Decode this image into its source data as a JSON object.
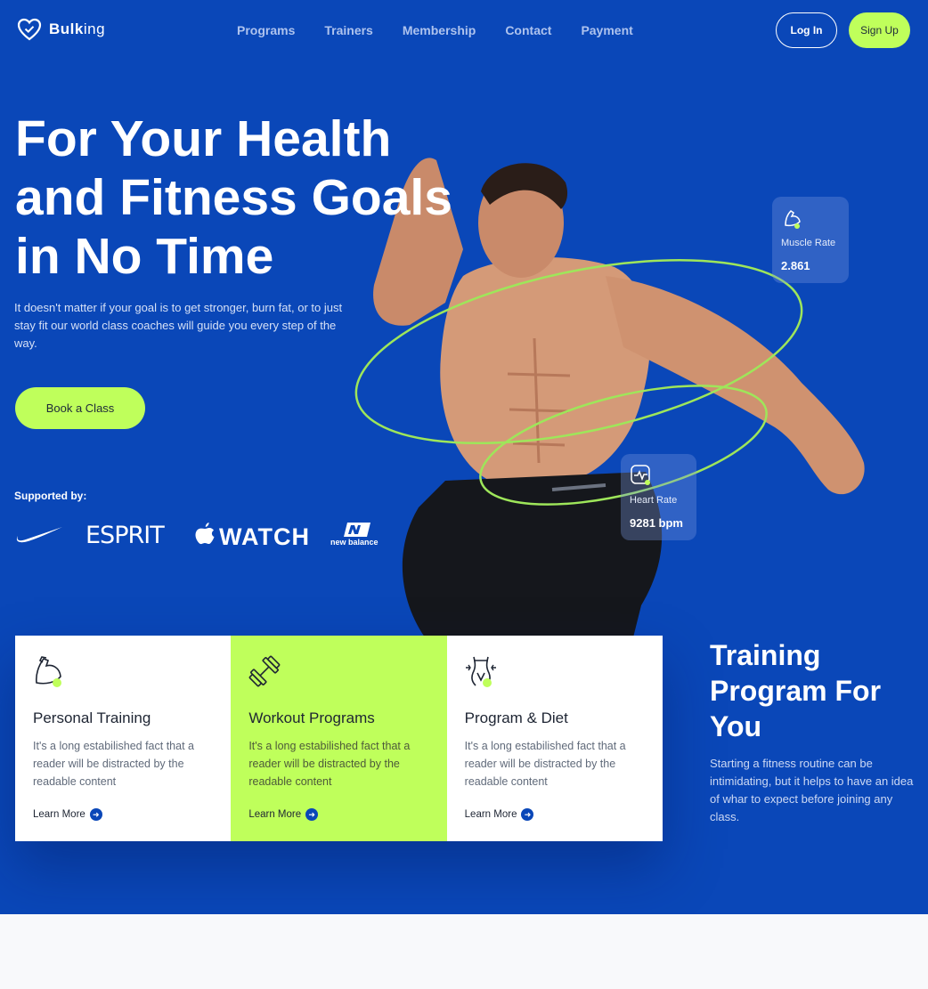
{
  "brand": {
    "name_bold": "Bulk",
    "name_thin": "ing"
  },
  "nav": {
    "items": [
      "Programs",
      "Trainers",
      "Membership",
      "Contact",
      "Payment"
    ],
    "login_label": "Log In",
    "signup_label": "Sign Up"
  },
  "hero": {
    "line1_normal": "For Your ",
    "line1_bold": "Health",
    "line2_normal": "and ",
    "line2_bold": "Fitness Goals",
    "line3": "in No Time",
    "subtext": "It doesn't matter if your goal is to get stronger, burn fat, or to just stay fit our world class coaches will guide you every step of the way.",
    "cta_label": "Book a Class"
  },
  "supporters": {
    "label": "Supported by:",
    "esprit": "ESPRIT",
    "watch": "WATCH",
    "newbalance": "new balance"
  },
  "stats": {
    "muscle": {
      "label": "Muscle Rate",
      "value": "2.861"
    },
    "heart": {
      "label": "Heart Rate",
      "value": "9281 bpm"
    }
  },
  "cards": [
    {
      "title": "Personal Training",
      "desc": "It's a long estabilished fact that a reader will be distracted by the readable content",
      "link": "Learn More",
      "icon": "muscle-arm-icon"
    },
    {
      "title": "Workout Programs",
      "desc": "It's a long estabilished fact that a reader will be distracted by the readable content",
      "link": "Learn More",
      "icon": "dumbbell-icon"
    },
    {
      "title": "Program & Diet",
      "desc": "It's a long estabilished fact that a reader will be distracted by the readable content",
      "link": "Learn More",
      "icon": "waist-icon"
    }
  ],
  "program": {
    "title": "Training Program For You",
    "text": "Starting a fitness routine can be intimidating, but it helps to have an idea of whar to expect before joining any class."
  },
  "colors": {
    "primary": "#0a47b8",
    "accent": "#bfff5b",
    "dark": "#1e2533"
  }
}
